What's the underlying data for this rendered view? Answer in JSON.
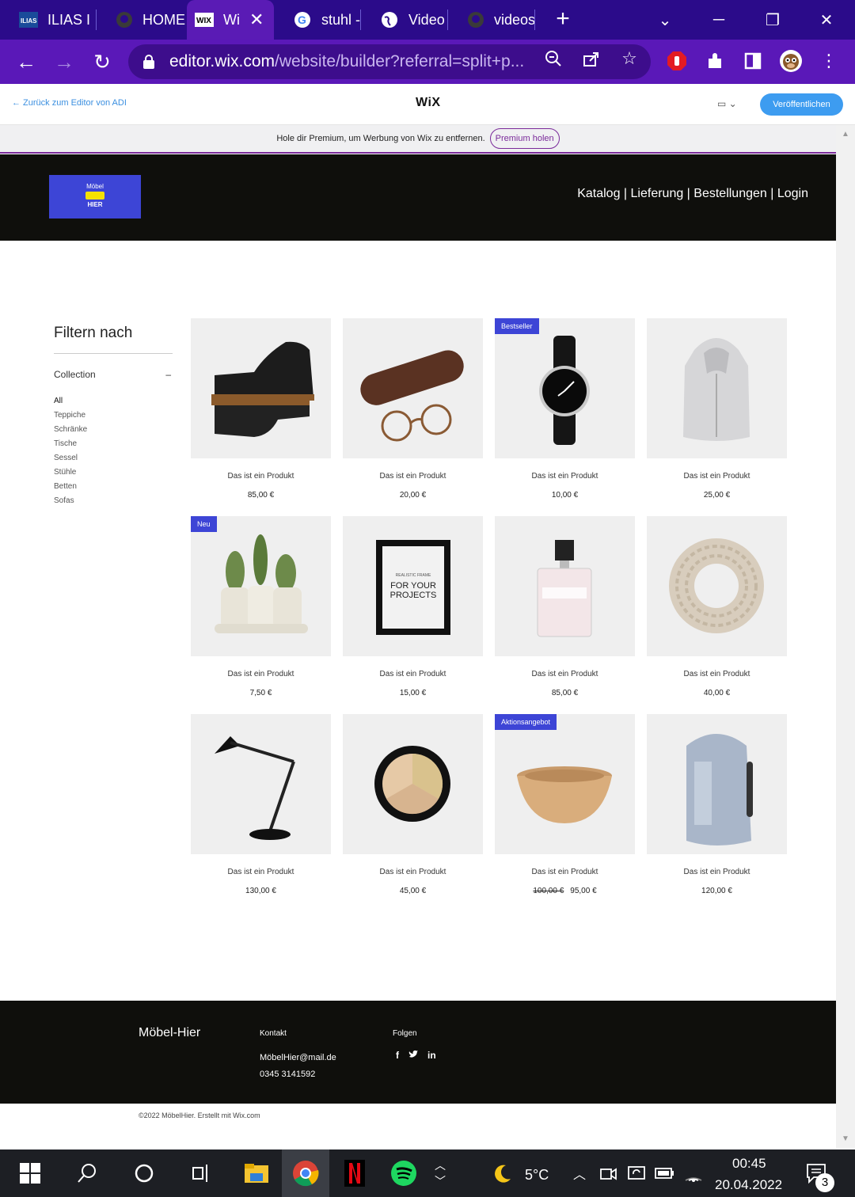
{
  "browser": {
    "tabs": [
      {
        "label": "ILIAS I",
        "icon": "ilias-icon"
      },
      {
        "label": "HOME",
        "icon": "github-icon"
      },
      {
        "label": "Wi",
        "icon": "wix-icon"
      },
      {
        "label": "stuhl -",
        "icon": "google-icon"
      },
      {
        "label": "Video",
        "icon": "globe-icon"
      },
      {
        "label": "videos",
        "icon": "github-icon"
      }
    ],
    "new_tab": "+",
    "url_host": "editor.wix.com",
    "url_path": "/website/builder?referral=split+p..."
  },
  "wix_bar": {
    "back_label": "← Zurück zum Editor von ADI",
    "logo": "WiX",
    "device_label": "▭ ⌄",
    "publish_label": "Veröffentlichen"
  },
  "premium": {
    "text": "Hole dir Premium, um Werbung von Wix zu entfernen.",
    "button": "Premium holen"
  },
  "site": {
    "logo_top": "Möbel",
    "logo_bottom": "HIER",
    "nav": "Katalog | Lieferung | Bestellungen | Login"
  },
  "filter": {
    "title": "Filtern nach",
    "collection": "Collection",
    "collapse": "–",
    "items": [
      "All",
      "Teppiche",
      "Schränke",
      "Tische",
      "Sessel",
      "Stühle",
      "Betten",
      "Sofas"
    ]
  },
  "products": [
    {
      "name": "Das ist ein Produkt",
      "price": "85,00 €",
      "ribbon": "",
      "old_price": "",
      "image": "shoes"
    },
    {
      "name": "Das ist ein Produkt",
      "price": "20,00 €",
      "ribbon": "",
      "old_price": "",
      "image": "glasses"
    },
    {
      "name": "Das ist ein Produkt",
      "price": "10,00 €",
      "ribbon": "Bestseller",
      "old_price": "",
      "image": "watch"
    },
    {
      "name": "Das ist ein Produkt",
      "price": "25,00 €",
      "ribbon": "",
      "old_price": "",
      "image": "hoodie"
    },
    {
      "name": "Das ist ein Produkt",
      "price": "7,50 €",
      "ribbon": "Neu",
      "old_price": "",
      "image": "cactus"
    },
    {
      "name": "Das ist ein Produkt",
      "price": "15,00 €",
      "ribbon": "",
      "old_price": "",
      "image": "frame",
      "frame_small": "REALISTIC FRAME",
      "frame_big": "FOR YOUR PROJECTS"
    },
    {
      "name": "Das ist ein Produkt",
      "price": "85,00 €",
      "ribbon": "",
      "old_price": "",
      "image": "perfume"
    },
    {
      "name": "Das ist ein Produkt",
      "price": "40,00 €",
      "ribbon": "",
      "old_price": "",
      "image": "scarf"
    },
    {
      "name": "Das ist ein Produkt",
      "price": "130,00 €",
      "ribbon": "",
      "old_price": "",
      "image": "lamp"
    },
    {
      "name": "Das ist ein Produkt",
      "price": "45,00 €",
      "ribbon": "",
      "old_price": "",
      "image": "palette"
    },
    {
      "name": "Das ist ein Produkt",
      "price": "95,00 €",
      "ribbon": "Aktionsangebot",
      "old_price": "100,00 €",
      "image": "bowl"
    },
    {
      "name": "Das ist ein Produkt",
      "price": "120,00 €",
      "ribbon": "",
      "old_price": "",
      "image": "backpack"
    }
  ],
  "footer": {
    "brand": "Möbel-Hier",
    "kontakt": "Kontakt",
    "email": "MöbelHier@mail.de",
    "phone": "0345 3141592",
    "folgen": "Folgen",
    "copyright": "©2022 MöbelHier. Erstellt mit Wix.com"
  },
  "taskbar": {
    "weather": "5°C",
    "time": "00:45",
    "date": "20.04.2022",
    "notifications": "3"
  }
}
